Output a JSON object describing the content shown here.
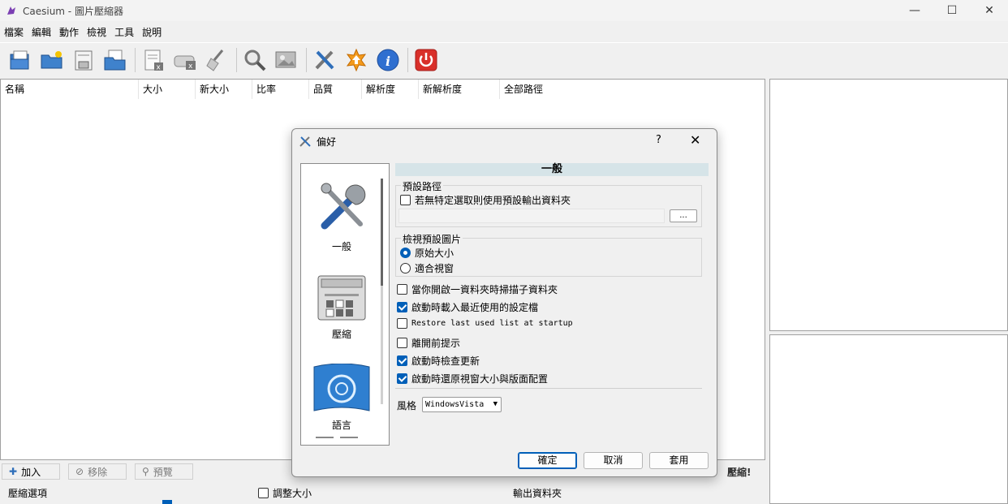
{
  "window": {
    "title": "Caesium - 圖片壓縮器"
  },
  "menu": [
    "檔案",
    "編輯",
    "動作",
    "檢視",
    "工具",
    "說明"
  ],
  "toolbar": {
    "icons": [
      "add-files-icon",
      "open-folder-icon",
      "save-list-icon",
      "open-list-icon",
      "remove-item-icon",
      "clear-list-icon",
      "clean-icon",
      "search-icon",
      "preview-icon",
      "preferences-icon",
      "update-icon",
      "info-icon",
      "power-icon"
    ]
  },
  "file_list": {
    "columns": [
      "名稱",
      "大小",
      "新大小",
      "比率",
      "品質",
      "解析度",
      "新解析度",
      "全部路徑"
    ]
  },
  "bottom": {
    "add": "加入",
    "remove": "移除",
    "preview": "預覽",
    "compress": "壓縮!",
    "compression_options": "壓縮選項",
    "resize": "調整大小",
    "output_folder": "輸出資料夾"
  },
  "dialog": {
    "title": "偏好",
    "help": "?",
    "nav": [
      "一般",
      "壓縮",
      "語言"
    ],
    "section_title": "一般",
    "default_path": {
      "label": "預設路徑",
      "checkbox": "若無特定選取則使用預設輸出資料夾",
      "value": "",
      "browse": "..."
    },
    "preview_default": {
      "label": "檢視預設圖片",
      "original": "原始大小",
      "fit": "適合視窗"
    },
    "options": [
      {
        "label": "當你開啟一資料夾時掃描子資料夾",
        "checked": false,
        "mono": false
      },
      {
        "label": "啟動時載入最近使用的設定檔",
        "checked": true,
        "mono": false
      },
      {
        "label": "Restore last used list at startup",
        "checked": false,
        "mono": true
      },
      {
        "label": "離開前提示",
        "checked": false,
        "mono": false
      },
      {
        "label": "啟動時檢查更新",
        "checked": true,
        "mono": false
      },
      {
        "label": "啟動時還原視窗大小與版面配置",
        "checked": true,
        "mono": false
      }
    ],
    "style_label": "風格",
    "style_value": "WindowsVista",
    "ok": "確定",
    "cancel": "取消",
    "apply": "套用"
  },
  "colors": {
    "accent": "#005fb8",
    "section_bg": "#d6e4e8"
  }
}
